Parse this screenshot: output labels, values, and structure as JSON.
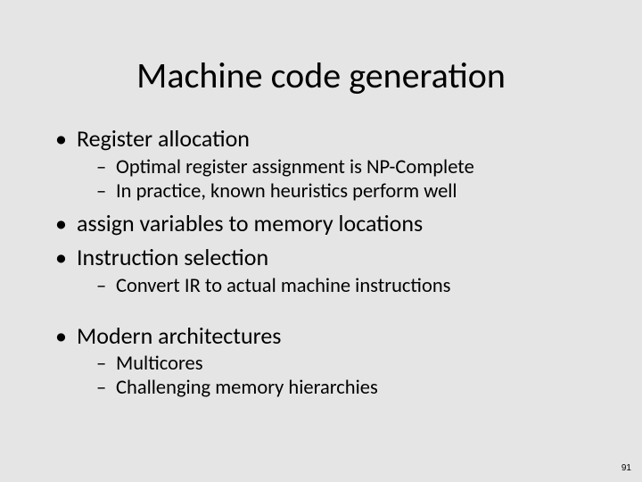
{
  "title": "Machine code generation",
  "bullets": {
    "b1": "Register allocation",
    "b1_sub1": "Optimal register assignment is NP-Complete",
    "b1_sub2": "In practice, known heuristics perform well",
    "b2": "assign variables to memory locations",
    "b3": "Instruction selection",
    "b3_sub1": "Convert IR to actual machine instructions",
    "b4": "Modern architectures",
    "b4_sub1": "Multicores",
    "b4_sub2": "Challenging memory hierarchies"
  },
  "page_number": "91"
}
